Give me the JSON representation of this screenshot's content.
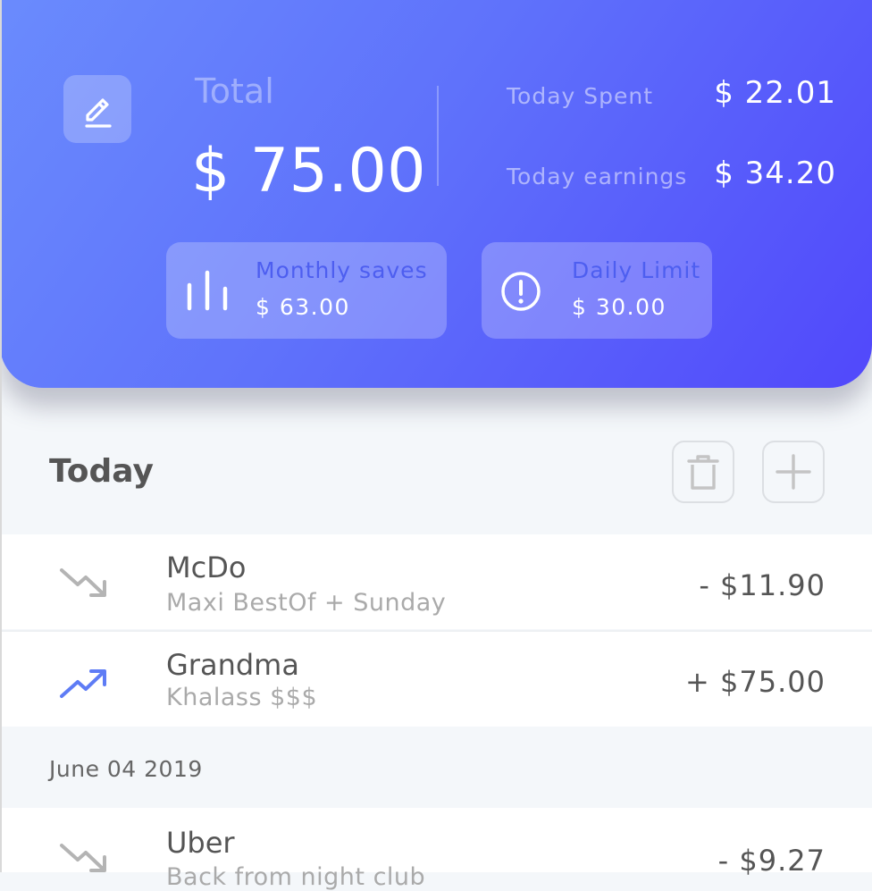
{
  "summary": {
    "total_label": "Total",
    "total_value": "$ 75.00",
    "today_spent_label": "Today Spent",
    "today_spent_value": "$ 22.01",
    "today_earnings_label": "Today earnings",
    "today_earnings_value": "$ 34.20",
    "edit_icon": "edit-pencil-icon"
  },
  "cards": [
    {
      "label": "Monthly saves",
      "value": "$ 63.00",
      "icon": "bar-chart-icon"
    },
    {
      "label": "Daily Limit",
      "value": "$ 30.00",
      "icon": "alert-circle-icon"
    }
  ],
  "today": {
    "title": "Today",
    "actions": [
      "trash-icon",
      "plus-icon"
    ],
    "transactions": [
      {
        "title": "McDo",
        "subtitle": "Maxi BestOf + Sunday",
        "amount": "- $11.90",
        "trend": "trend-down-icon"
      },
      {
        "title": "Grandma",
        "subtitle": "Khalass $$$",
        "amount": "+ $75.00",
        "trend": "trend-up-icon"
      }
    ]
  },
  "history": [
    {
      "date": "June 04 2019",
      "transactions": [
        {
          "title": "Uber",
          "subtitle": "Back from night club",
          "amount": "- $9.27",
          "trend": "trend-down-icon"
        }
      ]
    }
  ],
  "colors": {
    "gradient_start": "#6a8bfd",
    "gradient_end": "#5148fb",
    "accent_blue": "#4d5ef0",
    "trend_up": "#5e7cf5",
    "trend_down": "#b4b4b4"
  }
}
